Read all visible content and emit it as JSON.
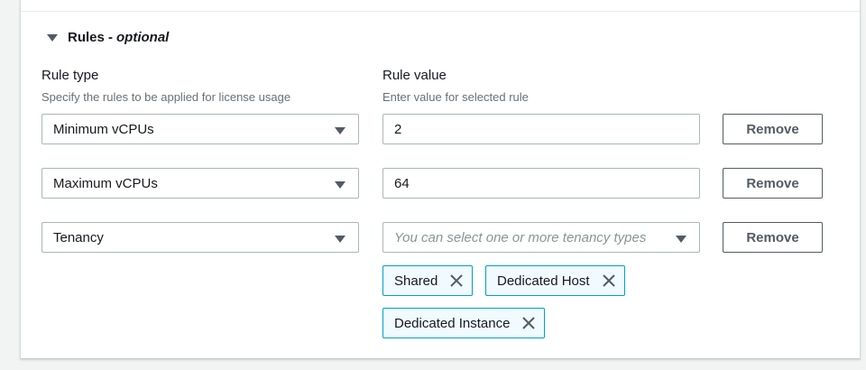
{
  "section": {
    "title": "Rules - ",
    "optional_label": "optional"
  },
  "rule_type": {
    "label": "Rule type",
    "description": "Specify the rules to be applied for license usage"
  },
  "rule_value": {
    "label": "Rule value",
    "description": "Enter value for selected rule"
  },
  "rules": [
    {
      "type": "Minimum vCPUs",
      "value": "2",
      "remove_label": "Remove"
    },
    {
      "type": "Maximum vCPUs",
      "value": "64",
      "remove_label": "Remove"
    },
    {
      "type": "Tenancy",
      "placeholder": "You can select one or more tenancy types",
      "remove_label": "Remove"
    }
  ],
  "tenancy_tokens": [
    "Shared",
    "Dedicated Host",
    "Dedicated Instance"
  ],
  "colors": {
    "token_border": "#00a1c9",
    "token_bg": "#f1faff",
    "button_border": "#545b64"
  },
  "icons": {
    "expand": "caret-down-icon",
    "dropdown": "caret-down-icon",
    "dismiss": "close-icon"
  }
}
